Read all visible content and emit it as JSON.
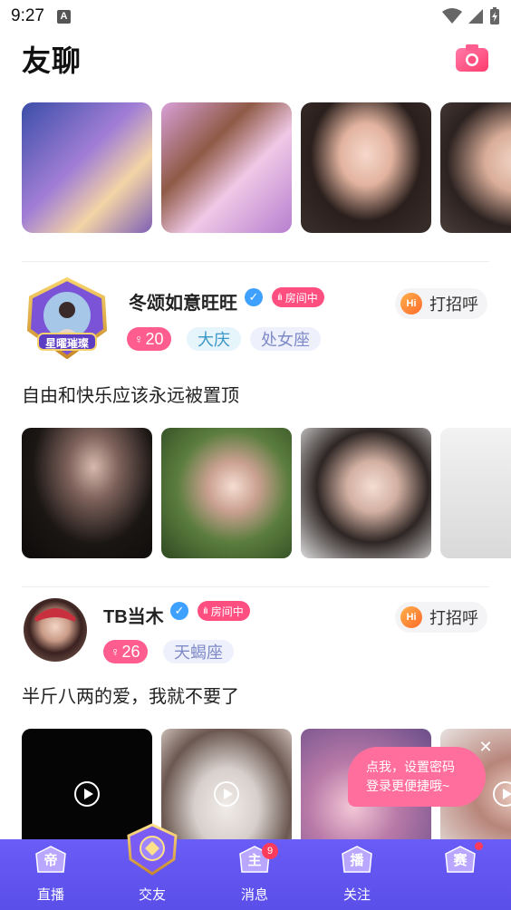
{
  "status_bar": {
    "time": "9:27",
    "notification_icon": "A"
  },
  "header": {
    "title": "友聊",
    "camera_icon": "camera-icon"
  },
  "posts": [
    {
      "username": "冬颂如意旺旺",
      "room_badge": "房间中",
      "greet_label": "打招呼",
      "greet_icon_text": "Hi",
      "age": "20",
      "tags": [
        "大庆",
        "处女座"
      ],
      "avatar_banner": "星曜璀璨",
      "text": "自由和快乐应该永远被置顶"
    },
    {
      "username": "TB当木",
      "room_badge": "房间中",
      "greet_label": "打招呼",
      "greet_icon_text": "Hi",
      "age": "26",
      "tags": [
        "天蝎座"
      ],
      "text": "半斤八两的爱，我就不要了"
    }
  ],
  "tooltip": {
    "line1": "点我，设置密码",
    "line2": "登录更便捷哦~"
  },
  "bottom_nav": {
    "items": [
      {
        "label": "直播",
        "emblem": "帝"
      },
      {
        "label": "交友",
        "emblem": ""
      },
      {
        "label": "消息",
        "emblem": "主",
        "badge": "9"
      },
      {
        "label": "关注",
        "emblem": "播"
      },
      {
        "label": "",
        "emblem": "赛"
      }
    ]
  },
  "colors": {
    "accent": "#ff5d8f",
    "nav_bg": "#6a5cf6",
    "verified": "#3ea0ff"
  }
}
